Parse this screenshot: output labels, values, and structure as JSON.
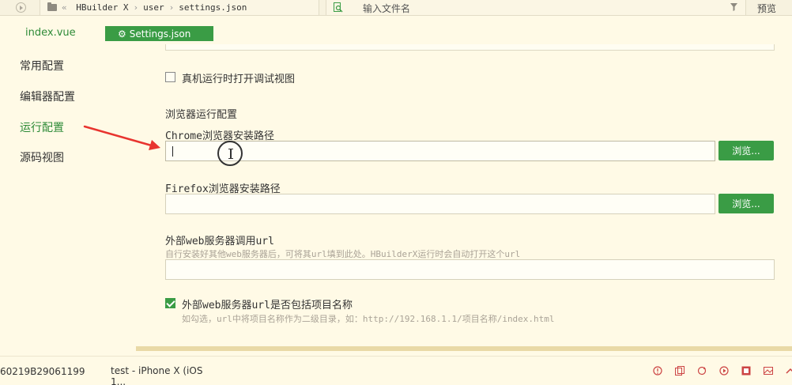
{
  "topbar": {
    "breadcrumb": [
      "HBuilder X",
      "user",
      "settings.json"
    ],
    "breadcrumb_prefix": "«",
    "search_placeholder": "输入文件名",
    "preview_label": "预览"
  },
  "tabs": [
    {
      "label": "index.vue",
      "active": false
    },
    {
      "label": "Settings.json",
      "active": true,
      "icon": "gear-icon"
    }
  ],
  "sidebar": {
    "items": [
      {
        "label": "常用配置",
        "active": false
      },
      {
        "label": "编辑器配置",
        "active": false
      },
      {
        "label": "运行配置",
        "active": true
      },
      {
        "label": "源码视图",
        "active": false
      }
    ]
  },
  "content": {
    "debug_view_label": "真机运行时打开调试视图",
    "debug_view_checked": false,
    "browser_section_title": "浏览器运行配置",
    "chrome_label": "Chrome浏览器安装路径",
    "chrome_value": "",
    "firefox_label": "Firefox浏览器安装路径",
    "firefox_value": "",
    "browse_label": "浏览...",
    "web_server_label": "外部web服务器调用url",
    "web_server_hint": "自行安装好其他web服务器后，可将其url填到此处。HBuilderX运行时会自动打开这个url",
    "web_server_value": "",
    "include_project_label": "外部web服务器url是否包括项目名称",
    "include_project_checked": true,
    "include_project_hint": "如勾选，url中将项目名称作为二级目录，如：http://192.168.1.1/项目名称/index.html"
  },
  "bottombar": {
    "device_id": "60219B29061199",
    "device_tab": "test - iPhone X (iOS 1..."
  },
  "colors": {
    "accent_green": "#3a9c45",
    "background": "#fffae6",
    "annotation_red": "#e8342f"
  }
}
